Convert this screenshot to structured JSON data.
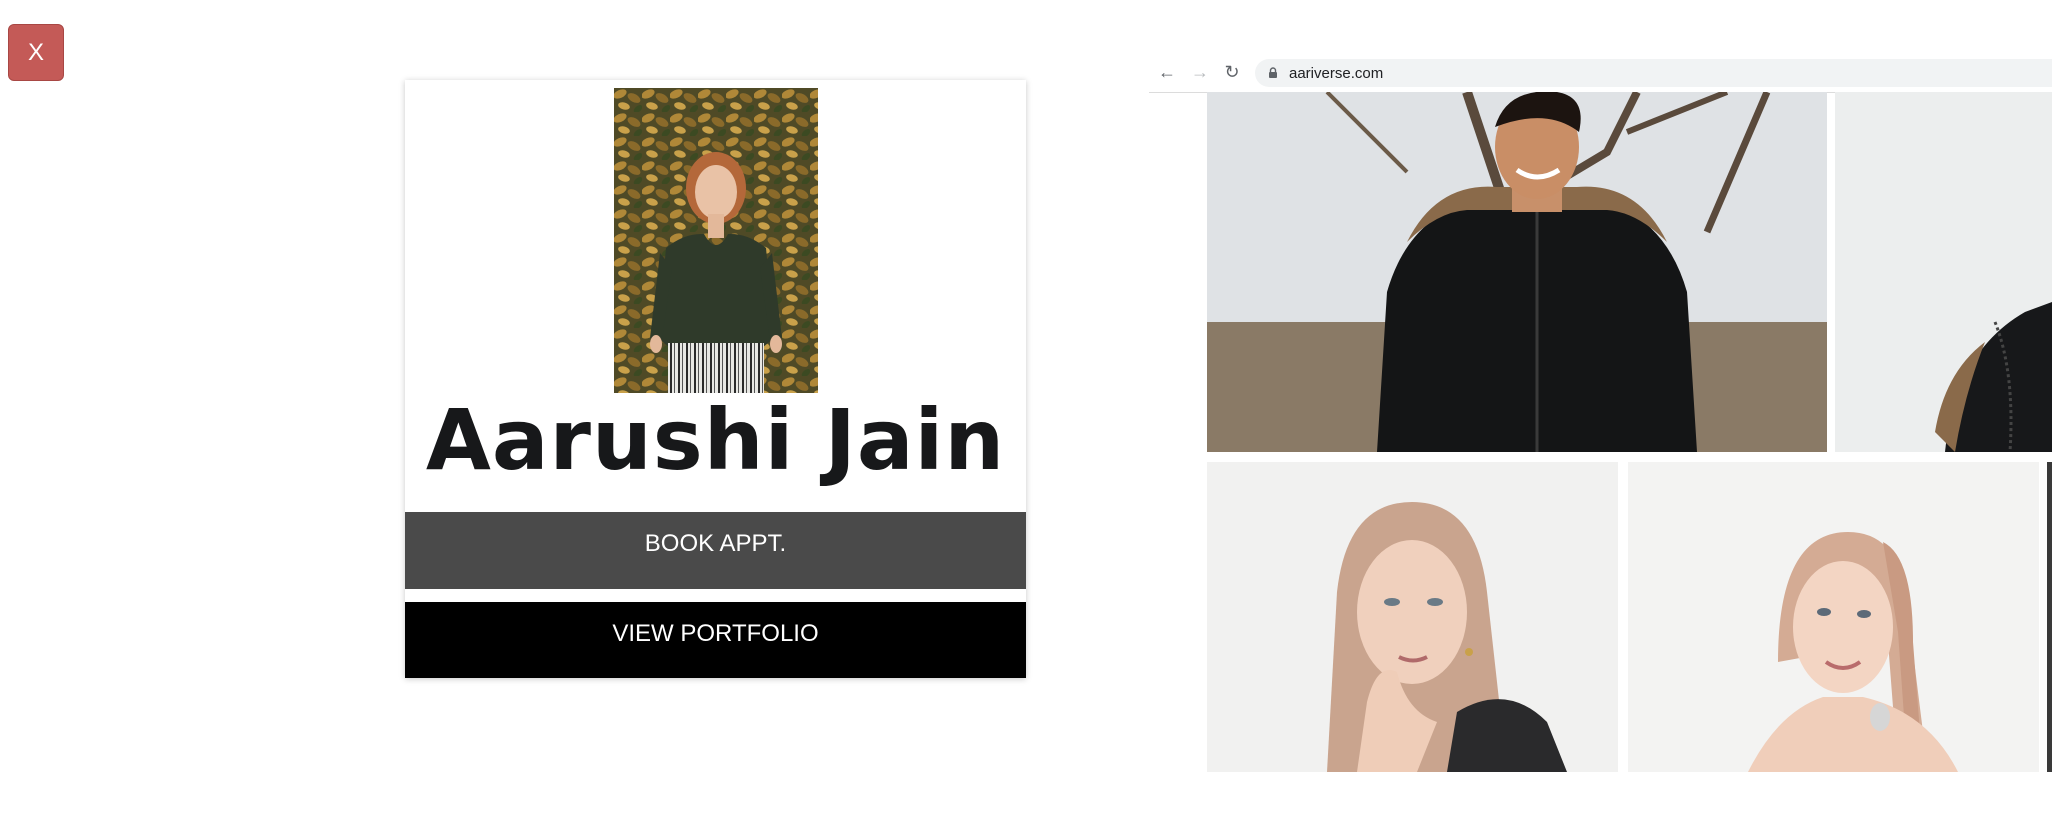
{
  "close_button": {
    "label": "X"
  },
  "profile": {
    "name": "Aarushi Jain",
    "book_label": "BOOK APPT.",
    "portfolio_label": "VIEW PORTFOLIO"
  },
  "browser": {
    "url": "aariverse.com"
  },
  "colors": {
    "close_button": "#c45a57",
    "book_button": "#4a4a4a",
    "portfolio_button": "#000000"
  }
}
